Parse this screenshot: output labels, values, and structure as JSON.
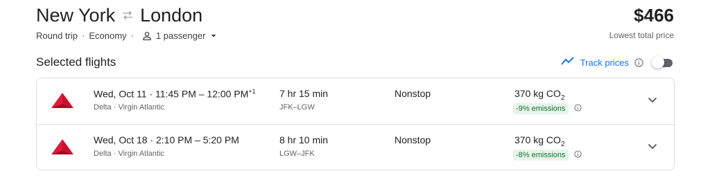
{
  "header": {
    "origin": "New York",
    "destination": "London",
    "trip_type": "Round trip",
    "cabin": "Economy",
    "passengers": "1 passenger",
    "dot": "·"
  },
  "price": {
    "amount": "$466",
    "label": "Lowest total price"
  },
  "section": {
    "title": "Selected flights",
    "track_label": "Track prices"
  },
  "flights": [
    {
      "date": "Wed, Oct 11",
      "dot": "·",
      "time_range": "11:45 PM – 12:00 PM",
      "day_offset": "+1",
      "airlines": "Delta · Virgin Atlantic",
      "duration": "7 hr 15 min",
      "airports": "JFK–LGW",
      "stops": "Nonstop",
      "co2_value": "370 kg CO",
      "co2_sub": "2",
      "emissions": "-9% emissions"
    },
    {
      "date": "Wed, Oct 18",
      "dot": "·",
      "time_range": "2:10 PM – 5:20 PM",
      "day_offset": "",
      "airlines": "Delta · Virgin Atlantic",
      "duration": "8 hr 10 min",
      "airports": "LGW–JFK",
      "stops": "Nonstop",
      "co2_value": "370 kg CO",
      "co2_sub": "2",
      "emissions": "-8% emissions"
    }
  ],
  "colors": {
    "accent": "#1a73e8",
    "delta_red": "#c8102e",
    "emissions_bg": "#e6f4ea",
    "emissions_text": "#137333"
  },
  "icons": {
    "swap": "swap-arrows-icon",
    "passenger": "person-icon",
    "dropdown": "caret-down-icon",
    "track": "trend-line-icon",
    "info": "info-icon",
    "expand": "chevron-down-icon",
    "airline_logo": "delta-logo-icon"
  }
}
